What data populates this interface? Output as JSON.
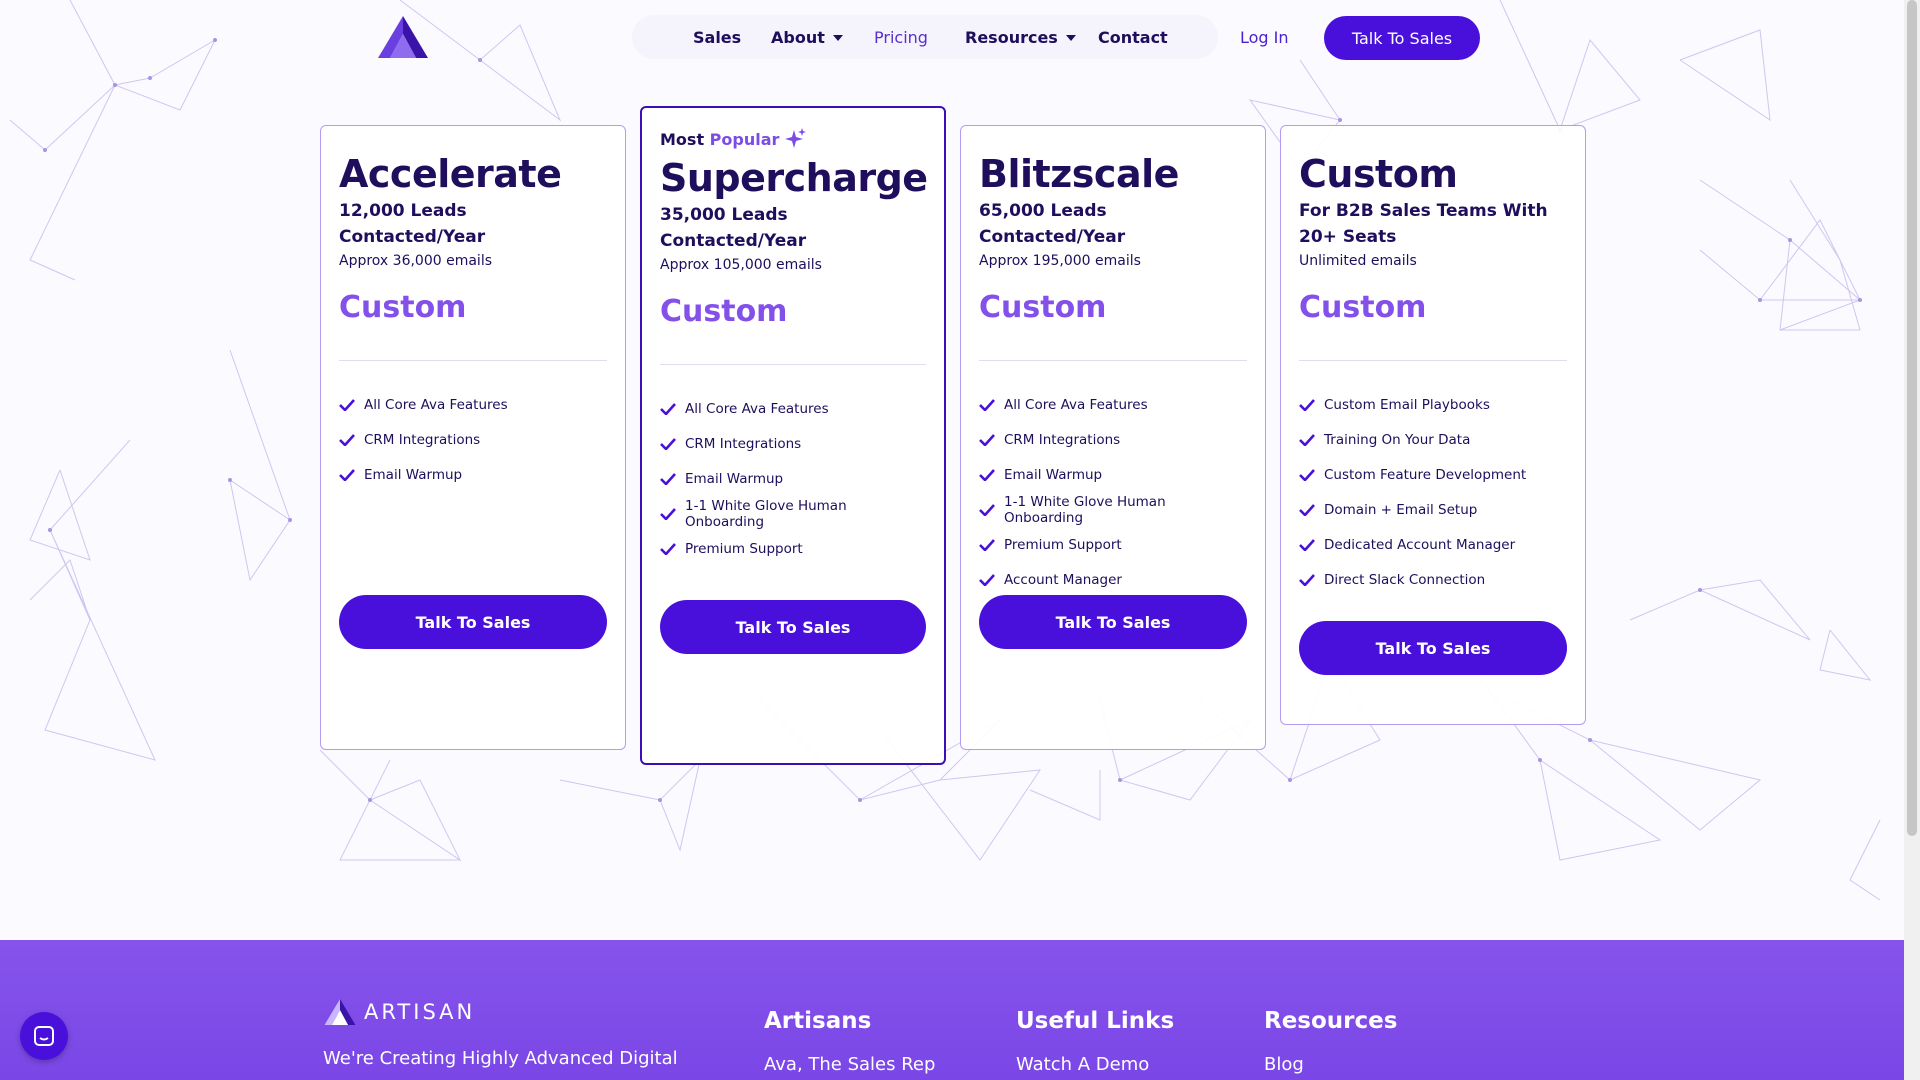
{
  "nav": {
    "items": [
      {
        "label": "Sales",
        "dropdown": false,
        "active": false
      },
      {
        "label": "About",
        "dropdown": true,
        "active": false
      },
      {
        "label": "Pricing",
        "dropdown": false,
        "active": true
      },
      {
        "label": "Resources",
        "dropdown": true,
        "active": false
      },
      {
        "label": "Contact",
        "dropdown": false,
        "active": false
      }
    ],
    "login_label": "Log In",
    "cta_label": "Talk To Sales"
  },
  "plans": [
    {
      "name": "Accelerate",
      "leads": "12,000 Leads Contacted/Year",
      "emails": "Approx 36,000 emails",
      "price": "Custom",
      "features": [
        "All Core Ava Features",
        "CRM Integrations",
        "Email Warmup"
      ],
      "cta": "Talk To Sales"
    },
    {
      "badge_prefix": "Most ",
      "badge_word": "Popular",
      "badge_icon": "sparkle-icon",
      "name": "Supercharge",
      "leads": "35,000 Leads Contacted/Year",
      "emails": "Approx 105,000 emails",
      "price": "Custom",
      "features": [
        "All Core Ava Features",
        "CRM Integrations",
        "Email Warmup",
        "1-1 White Glove Human Onboarding",
        "Premium Support"
      ],
      "cta": "Talk To Sales"
    },
    {
      "name": "Blitzscale",
      "leads": "65,000 Leads Contacted/Year",
      "emails": "Approx 195,000 emails",
      "price": "Custom",
      "features": [
        "All Core Ava Features",
        "CRM Integrations",
        "Email Warmup",
        "1-1 White Glove Human Onboarding",
        "Premium Support",
        "Account Manager"
      ],
      "cta": "Talk To Sales"
    },
    {
      "name": "Custom",
      "leads": "For B2B Sales Teams With 20+ Seats",
      "emails": "Unlimited emails",
      "price": "Custom",
      "features": [
        "Custom Email Playbooks",
        "Training On Your Data",
        "Custom Feature Development",
        "Domain + Email Setup",
        "Dedicated Account Manager",
        "Direct Slack Connection"
      ],
      "cta": "Talk To Sales"
    }
  ],
  "footer": {
    "brand": "ARTISAN",
    "tagline": "We're Creating Highly Advanced Digital",
    "columns": [
      {
        "heading": "Artisans",
        "first_link": "Ava, The Sales Rep"
      },
      {
        "heading": "Useful Links",
        "first_link": "Watch A Demo"
      },
      {
        "heading": "Resources",
        "first_link": "Blog"
      }
    ]
  },
  "icons": {
    "check": "check-icon",
    "caret": "caret-down-icon",
    "chat": "chat-icon",
    "logo": "artisan-logo"
  },
  "colors": {
    "primary": "#4a10db",
    "accent": "#8450ea",
    "text": "#1f0e5c",
    "footer": "#8654ec"
  }
}
